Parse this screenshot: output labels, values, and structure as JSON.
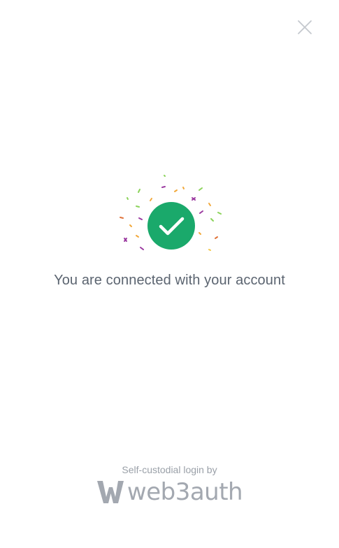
{
  "dialog": {
    "close_icon": "close-icon"
  },
  "status": {
    "icon": "check-circle-icon",
    "accent_color": "#1aa96b",
    "message": "You are connected with your account"
  },
  "footer": {
    "caption": "Self-custodial login by",
    "brand_name": "web3auth",
    "brand_icon": "web3auth-logo-icon"
  }
}
